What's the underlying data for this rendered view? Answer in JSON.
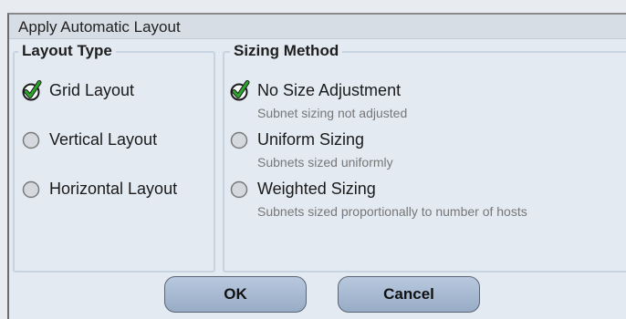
{
  "dialog": {
    "title": "Apply Automatic Layout"
  },
  "layout_type": {
    "legend": "Layout Type",
    "options": [
      {
        "label": "Grid Layout",
        "checked": true
      },
      {
        "label": "Vertical Layout",
        "checked": false
      },
      {
        "label": "Horizontal Layout",
        "checked": false
      }
    ]
  },
  "sizing_method": {
    "legend": "Sizing Method",
    "options": [
      {
        "label": "No Size Adjustment",
        "description": "Subnet sizing not adjusted",
        "checked": true
      },
      {
        "label": "Uniform Sizing",
        "description": "Subnets sized uniformly",
        "checked": false
      },
      {
        "label": "Weighted Sizing",
        "description": "Subnets sized proportionally to number of hosts",
        "checked": false
      }
    ]
  },
  "buttons": {
    "ok": "OK",
    "cancel": "Cancel"
  },
  "icons": {
    "checked": "green-checkmark-icon",
    "unchecked": "radio-empty-icon"
  },
  "colors": {
    "check_green": "#2aa52a",
    "button_blue": "#a9bcd5"
  }
}
